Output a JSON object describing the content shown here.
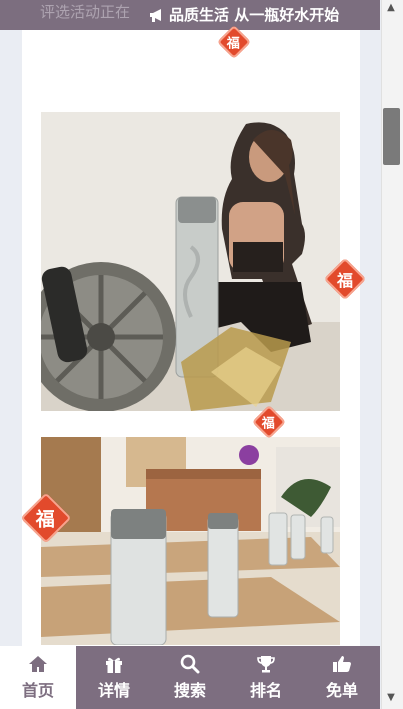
{
  "banner": {
    "ghost_text": "评选活动正在",
    "message": "品质生活 从一瓶好水开始",
    "icon": "megaphone-icon"
  },
  "stickers": {
    "fu_char": "福"
  },
  "nav": {
    "items": [
      {
        "label": "首页",
        "icon": "home-icon",
        "active": true
      },
      {
        "label": "详情",
        "icon": "gift-icon",
        "active": false
      },
      {
        "label": "搜索",
        "icon": "search-icon",
        "active": false
      },
      {
        "label": "排名",
        "icon": "trophy-icon",
        "active": false
      },
      {
        "label": "免单",
        "icon": "thumbs-up-icon",
        "active": false
      }
    ]
  },
  "colors": {
    "accent": "#7d6e80",
    "sticker": "#e24a2c",
    "page_bg": "#eaedf3"
  }
}
